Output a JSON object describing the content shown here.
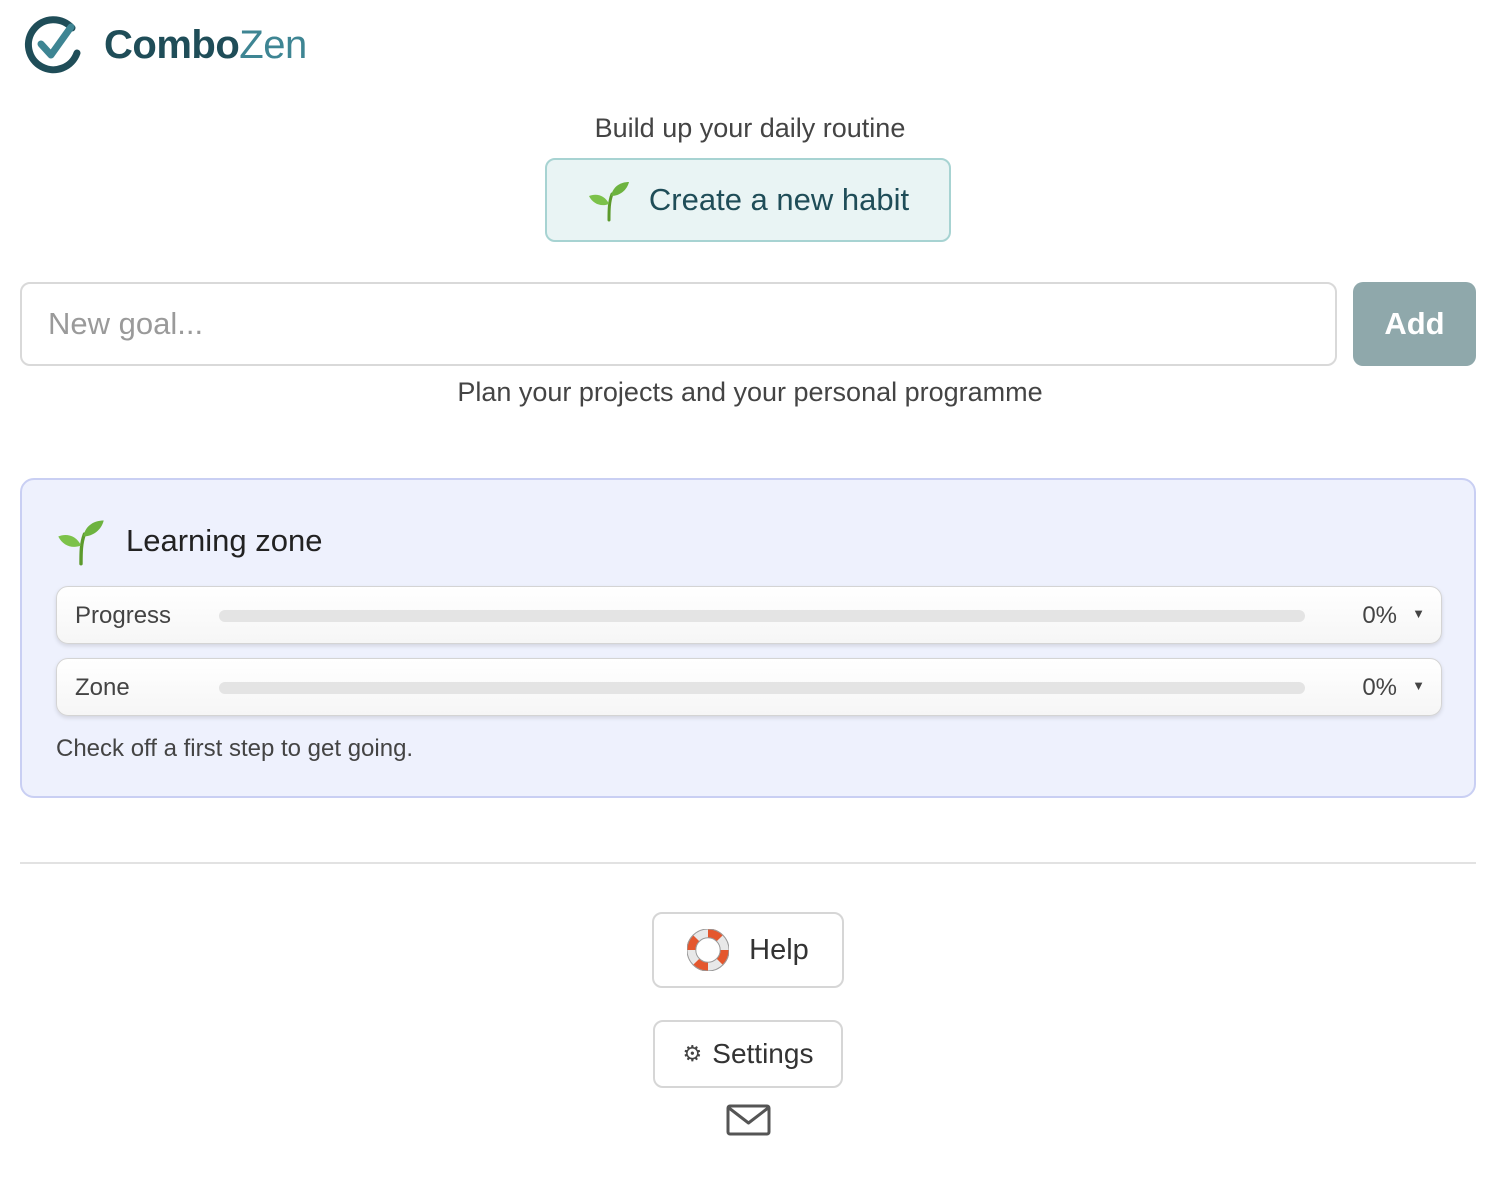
{
  "brand": {
    "name_part1": "Combo",
    "name_part2": "Zen",
    "colors": {
      "dark": "#1f4d58",
      "light": "#3e8593"
    }
  },
  "header": {
    "tagline": "Build up your daily routine",
    "create_button": {
      "icon": "sprout-icon",
      "label": "Create a new habit"
    }
  },
  "goal_form": {
    "input_value": "",
    "input_placeholder": "New goal...",
    "add_label": "Add",
    "subtitle": "Plan your projects and your personal programme"
  },
  "zone": {
    "icon": "sprout-icon",
    "title": "Learning zone",
    "rows": [
      {
        "label": "Progress",
        "percent_text": "0%",
        "value": 0
      },
      {
        "label": "Zone",
        "percent_text": "0%",
        "value": 0
      }
    ],
    "hint": "Check off a first step to get going."
  },
  "footer": {
    "help": {
      "icon": "lifebuoy-icon",
      "label": "Help"
    },
    "settings": {
      "icon": "gear-icon",
      "label": "Settings"
    },
    "contact_icon": "mail-icon"
  }
}
